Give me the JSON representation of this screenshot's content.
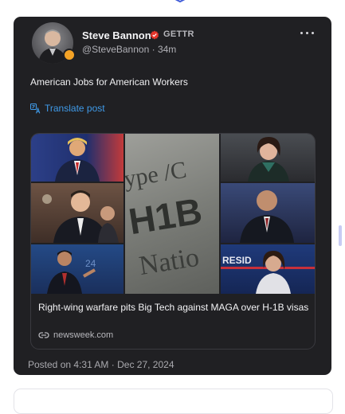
{
  "post": {
    "author_name": "Steve Bannon",
    "platform_label": "GETTR",
    "handle": "@SteveBannon",
    "separator": "·",
    "time_ago": "34m",
    "text": "American Jobs for American Workers",
    "translate_label": "Translate post",
    "posted_prefix": "Posted on",
    "posted_time": "4:31 AM",
    "posted_date": "Dec 27, 2024"
  },
  "link_preview": {
    "headline": "Right-wing warfare pits Big Tech against MAGA over H-1B visas",
    "domain": "newsweek.com",
    "image_text": {
      "top": "ype /C",
      "middle": "H1B",
      "bottom": "Natio",
      "banner": "RESID"
    }
  },
  "icons": {
    "verified": "verified-red-badge-icon",
    "more": "more-horizontal-icon",
    "translate": "translate-icon",
    "link": "link-icon"
  },
  "colors": {
    "card_bg": "#202023",
    "accent_link": "#3f9ae8",
    "verified": "#e5352b",
    "badge": "#f4a326"
  }
}
